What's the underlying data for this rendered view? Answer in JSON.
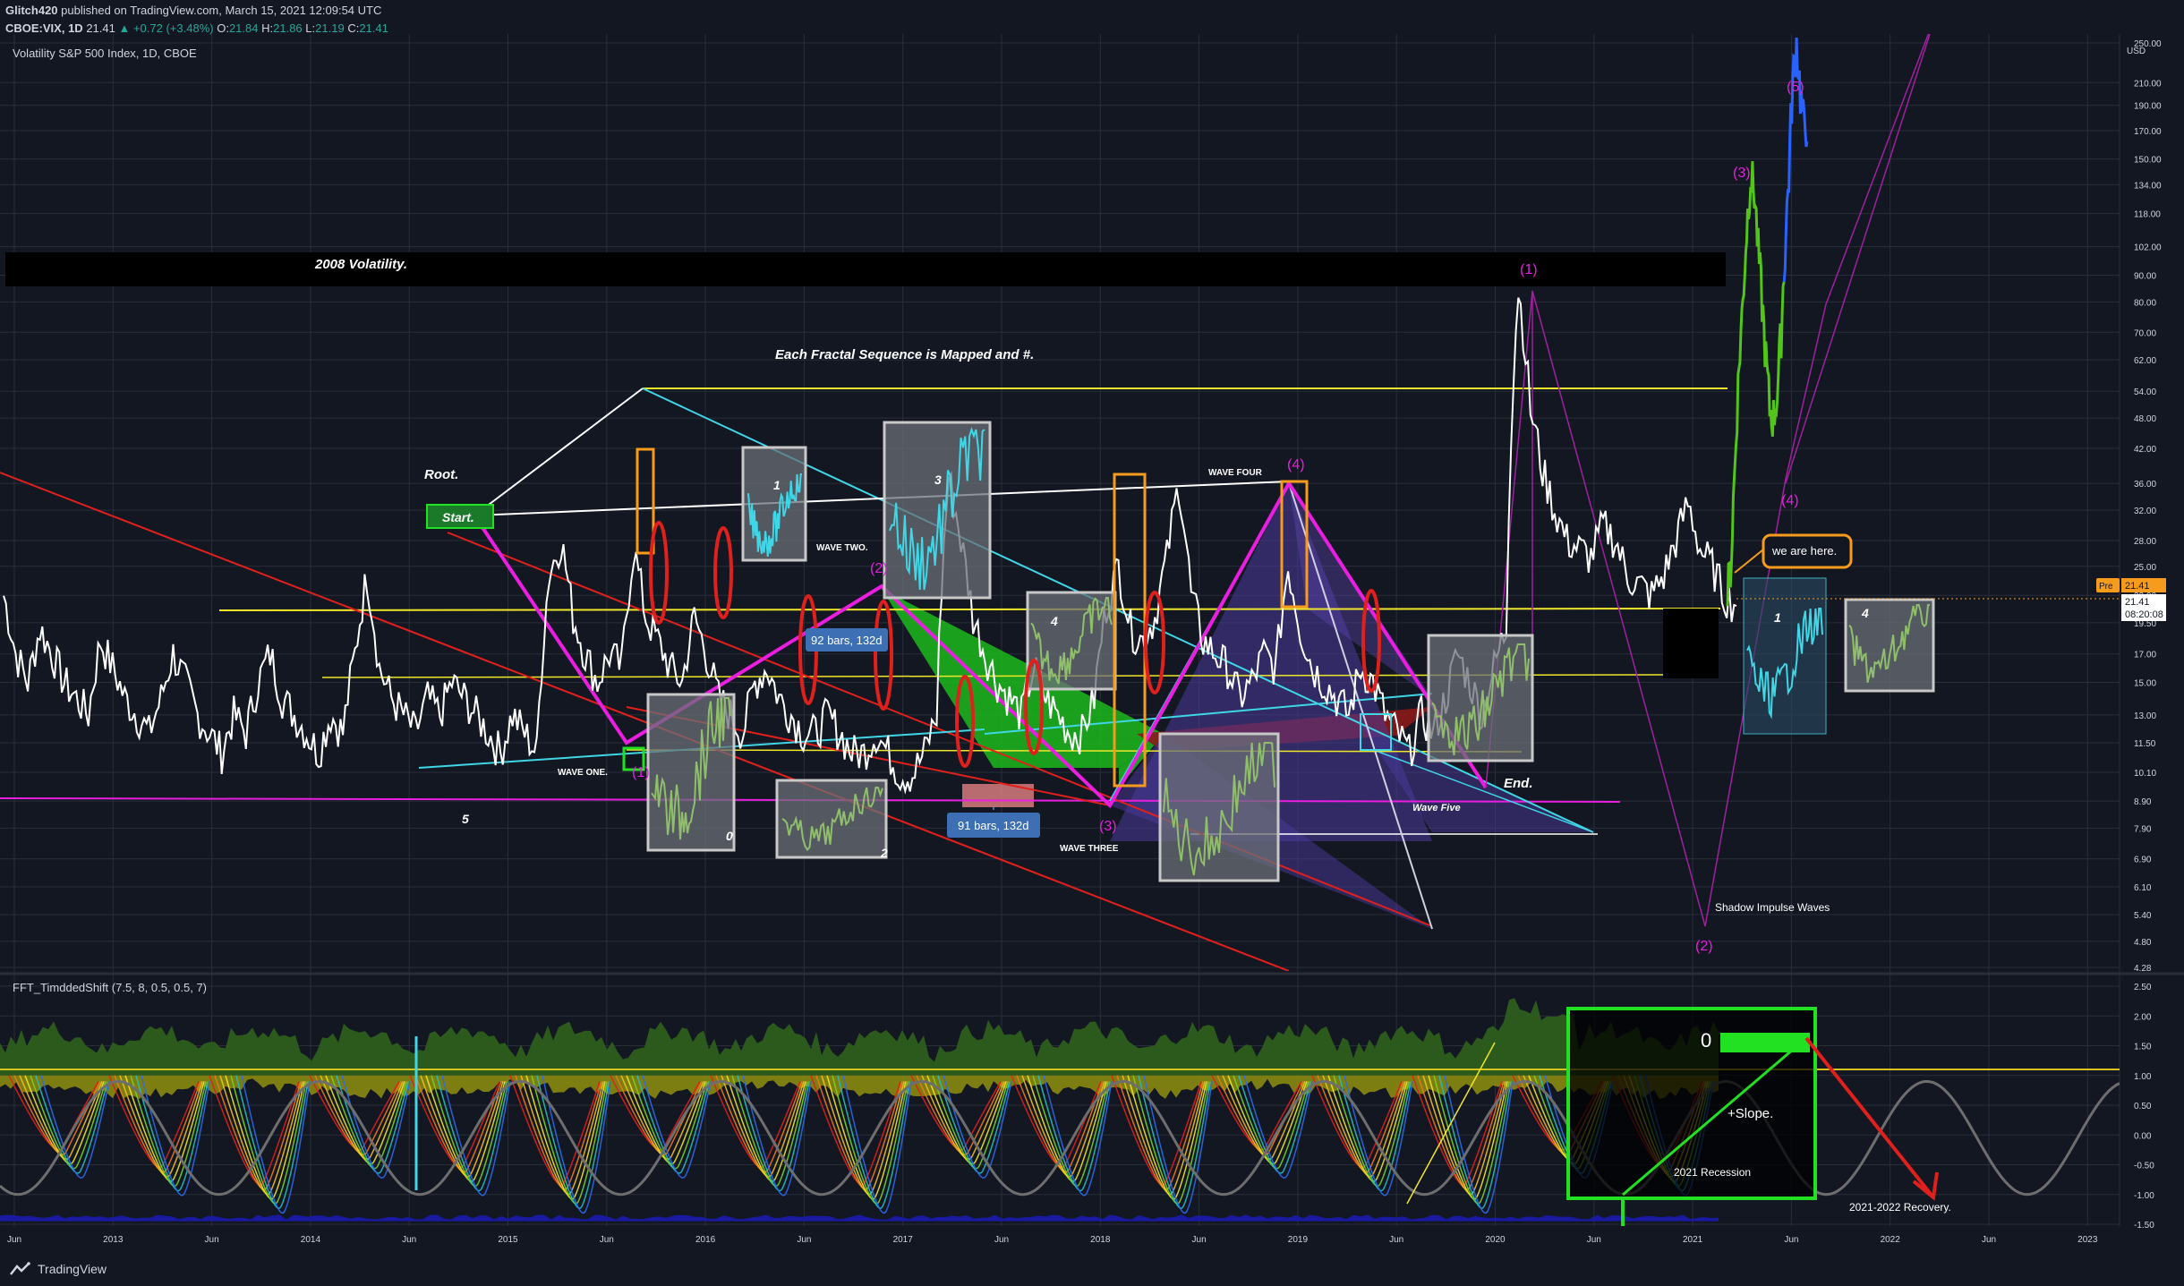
{
  "header": {
    "publisher": "Glitch420",
    "published_text": "published on TradingView.com, March 15, 2021 12:09:54 UTC",
    "symbol_line": "CBOE:VIX, 1D",
    "last": "21.41",
    "change": "▲ +0.72 (+3.48%)",
    "o_label": "O:",
    "o": "21.84",
    "h_label": "H:",
    "h": "21.86",
    "l_label": "L:",
    "l": "21.19",
    "c_label": "C:",
    "c": "21.41"
  },
  "main_pane": {
    "legend": "Volatility S&P 500 Index, 1D, CBOE",
    "currency": "USD",
    "price_tag": "21.41",
    "pre_tag": "Pre",
    "pre_value": "21.41",
    "countdown": "08:20:08"
  },
  "indicator_pane": {
    "legend": "FFT_TimddedShift (7.5, 8, 0.5, 0.5, 7)"
  },
  "annotations": {
    "volatility_2008": "2008 Volatility.",
    "fractal_note": "Each Fractal Sequence is Mapped and #.",
    "root": "Root.",
    "start": "Start.",
    "end": "End.",
    "wave_one": "WAVE ONE.",
    "wave_two": "WAVE TWO.",
    "wave_three": "WAVE THREE",
    "wave_four": "WAVE FOUR",
    "wave_five": "Wave Five",
    "w1": "(1)",
    "w2": "(2)",
    "w3": "(3)",
    "w4": "(4)",
    "w5": "(5)",
    "box_1": "1",
    "box_2": "2",
    "box_3": "3",
    "box_4": "4",
    "box_0": "0",
    "five": "5",
    "bars_a": "92 bars, 132d",
    "bars_b": "91 bars, 132d",
    "we_are_here": "we are here.",
    "shadow_waves": "Shadow Impulse Waves",
    "zero": "0",
    "slope": "+Slope.",
    "recession": "2021 Recession",
    "recovery": "2021-2022 Recovery.",
    "brand": "TradingView"
  },
  "colors": {
    "background": "#131722",
    "price_line": "#ffffff",
    "magenta": "#e91ee0",
    "yellow": "#f0e62a",
    "cyan": "#3fd6e6",
    "red": "#e0201c",
    "green": "#22e022",
    "orange": "#f79b1d",
    "blue": "#2962ff"
  },
  "chart_data": {
    "type": "line",
    "x_axis_ticks": [
      "Jun",
      "2013",
      "Jun",
      "2014",
      "Jun",
      "2015",
      "Jun",
      "2016",
      "Jun",
      "2017",
      "Jun",
      "2018",
      "Jun",
      "2019",
      "Jun",
      "2020",
      "Jun",
      "2021",
      "Jun",
      "2022",
      "Jun",
      "2023"
    ],
    "y_axis_ticks_main": [
      "250.00",
      "210.00",
      "190.00",
      "170.00",
      "150.00",
      "134.00",
      "118.00",
      "102.00",
      "90.00",
      "80.00",
      "70.00",
      "62.00",
      "54.00",
      "48.00",
      "42.00",
      "36.00",
      "32.00",
      "28.00",
      "25.00",
      "22.00",
      "19.50",
      "17.00",
      "15.00",
      "13.00",
      "11.50",
      "10.10",
      "8.90",
      "7.90",
      "6.90",
      "6.10",
      "5.40",
      "4.80",
      "4.28"
    ],
    "y_axis_ticks_indicator": [
      "2.50",
      "2.00",
      "1.50",
      "1.00",
      "0.50",
      "0.00",
      "-0.50",
      "-1.00",
      "-1.50"
    ],
    "y_scale": "log",
    "ylim": [
      4.28,
      250
    ],
    "series": [
      {
        "values": [
          22,
          17,
          15,
          19,
          17,
          15,
          14,
          13,
          18,
          16,
          14,
          13,
          12,
          14,
          17,
          15,
          13,
          12,
          11,
          13,
          12,
          15,
          17,
          14,
          13,
          12,
          11,
          13,
          12,
          17,
          24,
          16,
          14,
          13,
          12,
          14,
          13,
          15,
          14,
          13,
          12,
          11,
          13,
          12,
          11,
          24,
          28,
          20,
          17,
          15,
          17,
          16,
          27,
          20,
          18,
          16,
          15,
          20,
          17,
          14,
          13,
          12,
          15,
          16,
          14,
          13,
          12,
          12,
          13,
          12,
          11,
          11,
          12,
          11,
          10,
          10,
          11,
          13,
          37,
          28,
          20,
          17,
          15,
          14,
          13,
          16,
          14,
          13,
          12,
          12,
          14,
          21,
          25,
          19,
          18,
          20,
          26,
          36,
          22,
          18,
          17,
          16,
          14,
          15,
          17,
          16,
          25,
          19,
          16,
          15,
          14,
          13,
          16,
          15,
          13,
          12,
          11,
          13,
          12,
          14,
          17,
          15,
          13,
          16,
          19,
          85,
          50,
          38,
          32,
          28,
          27,
          26,
          30,
          28,
          24,
          23,
          22,
          24,
          28,
          33,
          27,
          25,
          22,
          21
        ]
      },
      {
        "values": [
          22,
          26,
          40,
          60,
          80,
          110,
          140,
          130,
          100,
          80,
          62,
          50,
          48,
          54,
          70,
          100,
          140,
          210,
          250,
          200,
          170,
          180
        ]
      }
    ],
    "indicator": {
      "type": "oscillator",
      "wave_amplitude": 1.0
    }
  }
}
